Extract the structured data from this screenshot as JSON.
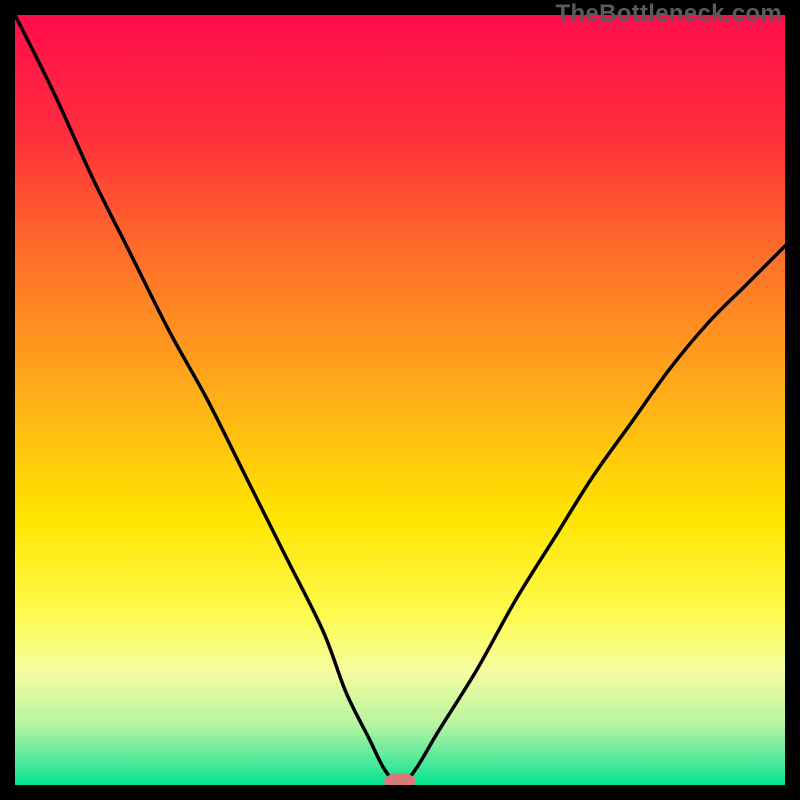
{
  "watermark": "TheBottleneck.com",
  "chart_data": {
    "type": "line",
    "title": "",
    "xlabel": "",
    "ylabel": "",
    "xlim": [
      0,
      100
    ],
    "ylim": [
      0,
      100
    ],
    "x": [
      0,
      5,
      10,
      15,
      20,
      25,
      30,
      35,
      40,
      43,
      46,
      48,
      50,
      52,
      55,
      60,
      65,
      70,
      75,
      80,
      85,
      90,
      95,
      100
    ],
    "values": [
      100,
      90,
      79,
      69,
      59,
      50,
      40,
      30,
      20,
      12,
      6,
      2,
      0,
      2,
      7,
      15,
      24,
      32,
      40,
      47,
      54,
      60,
      65,
      70
    ],
    "gradient_stops": [
      {
        "offset": 0,
        "color": "#ff0d4c"
      },
      {
        "offset": 15,
        "color": "#ff2d3d"
      },
      {
        "offset": 30,
        "color": "#ff6a2a"
      },
      {
        "offset": 50,
        "color": "#ffb018"
      },
      {
        "offset": 65,
        "color": "#ffe400"
      },
      {
        "offset": 78,
        "color": "#fdfb50"
      },
      {
        "offset": 85,
        "color": "#f7fda0"
      },
      {
        "offset": 92,
        "color": "#b8f5a0"
      },
      {
        "offset": 97,
        "color": "#4de89a"
      },
      {
        "offset": 100,
        "color": "#00e58f"
      }
    ],
    "marker": {
      "x": 50,
      "y": 0,
      "color": "#d87a7a"
    },
    "annotations": []
  }
}
